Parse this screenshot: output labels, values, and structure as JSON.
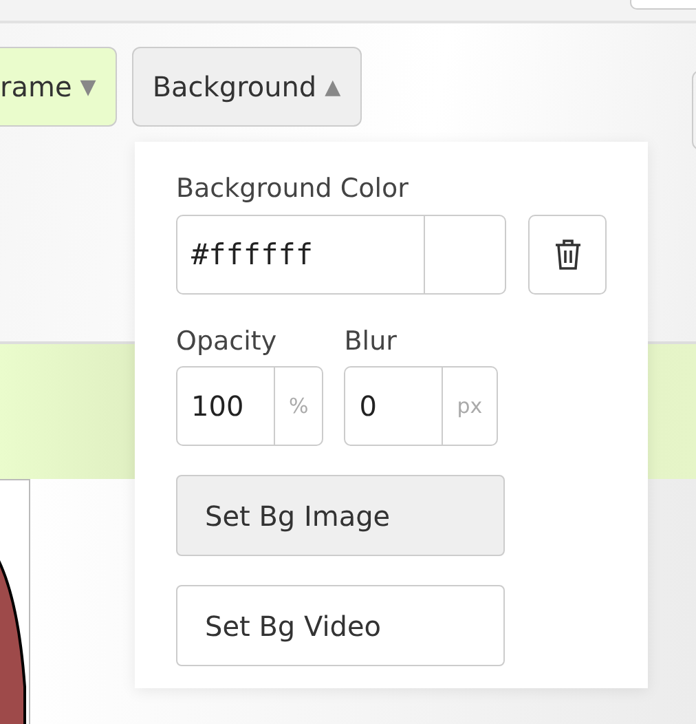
{
  "toolbar": {
    "buttons": [
      {
        "label": "rame",
        "caret": "▼",
        "highlighted": true
      },
      {
        "label": "Background",
        "caret": "▲",
        "highlighted": false
      }
    ]
  },
  "background_popover": {
    "color_label": "Background Color",
    "color_value": "#ffffff",
    "fields": [
      {
        "label": "Opacity",
        "value": "100",
        "unit": "%"
      },
      {
        "label": "Blur",
        "value": "0",
        "unit": "px"
      }
    ],
    "buttons": [
      {
        "label": "Set Bg Image",
        "highlighted": true
      },
      {
        "label": "Set Bg Video",
        "highlighted": false
      }
    ]
  }
}
